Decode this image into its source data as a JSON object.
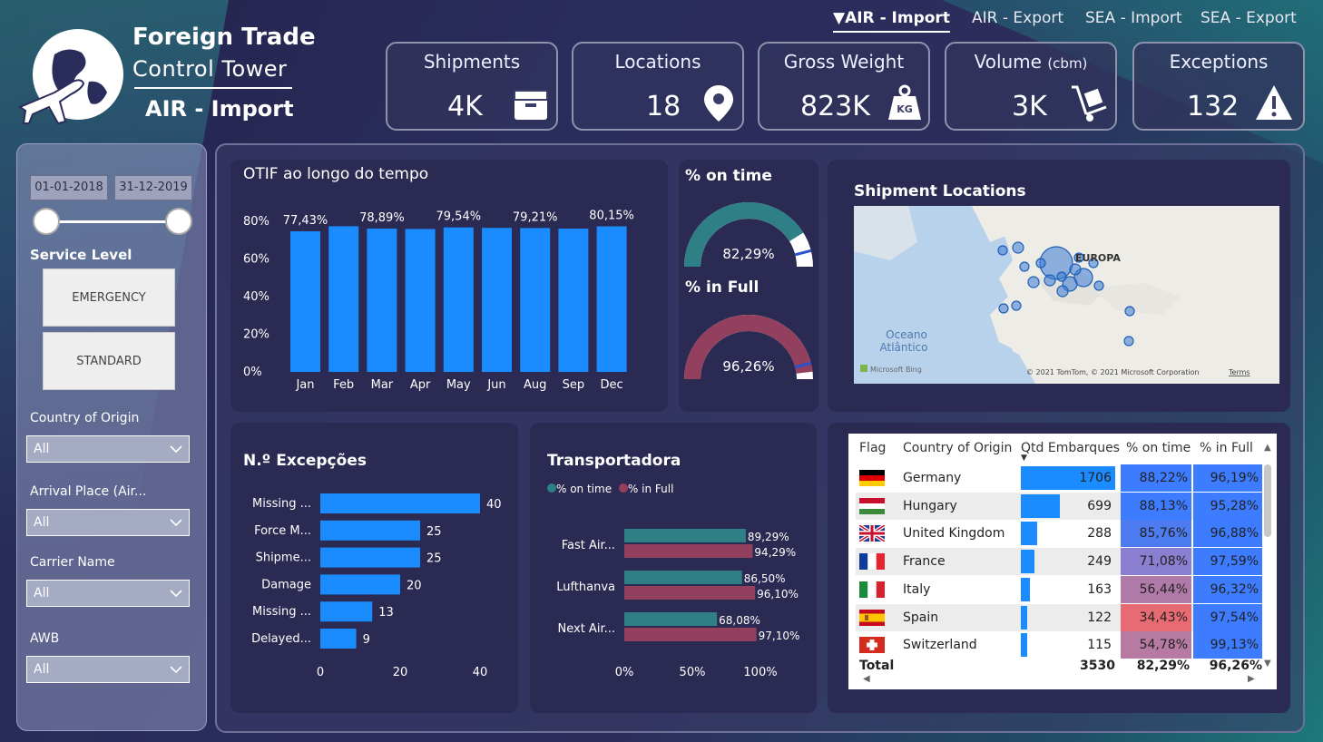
{
  "brand": {
    "line1": "Foreign Trade",
    "line2": "Control Tower",
    "subtitle": "AIR - Import"
  },
  "nav": [
    {
      "label": "AIR - Import",
      "active": true,
      "marker": "▼"
    },
    {
      "label": "AIR - Export",
      "active": false
    },
    {
      "label": "SEA - Import",
      "active": false
    },
    {
      "label": "SEA - Export",
      "active": false
    }
  ],
  "kpis": [
    {
      "label": "Shipments",
      "value": "4K",
      "icon": "box-icon"
    },
    {
      "label": "Locations",
      "value": "18",
      "icon": "map-pin-icon"
    },
    {
      "label": "Gross Weight",
      "value": "823K",
      "icon": "weight-kg-icon",
      "icon_text": "KG"
    },
    {
      "label": "Volume",
      "unit": "(cbm)",
      "value": "3K",
      "icon": "hand-truck-icon"
    },
    {
      "label": "Exceptions",
      "value": "132",
      "icon": "warning-icon"
    }
  ],
  "filters": {
    "date_from": "01-01-2018",
    "date_to": "31-12-2019",
    "service_level_label": "Service Level",
    "service_levels": [
      "EMERGENCY",
      "STANDARD"
    ],
    "dropdowns": [
      {
        "label": "Country of Origin",
        "value": "All"
      },
      {
        "label": "Arrival Place (Air...",
        "value": "All"
      },
      {
        "label": "Carrier Name",
        "value": "All"
      },
      {
        "label": "AWB",
        "value": "All"
      }
    ]
  },
  "otif": {
    "title": "OTIF ao longo do tempo"
  },
  "gauges": {
    "ontime_title": "% on time",
    "ontime_value": "82,29%",
    "ontime_fraction": 0.8229,
    "infull_title": "% in Full",
    "infull_value": "96,26%",
    "infull_fraction": 0.9626
  },
  "map": {
    "title": "Shipment Locations",
    "region_label": "EUROPA",
    "ocean_label_1": "Oceano",
    "ocean_label_2": "Atlântico",
    "bing": "Microsoft Bing",
    "copyright": "© 2021 TomTom, © 2021 Microsoft Corporation",
    "terms": "Terms"
  },
  "exceptions": {
    "title": "N.º Excepções"
  },
  "carriers": {
    "title": "Transportadora",
    "legend": [
      "% on time",
      "% in Full"
    ]
  },
  "table": {
    "headers": [
      "Flag",
      "Country of Origin",
      "Qtd Embarques",
      "% on time",
      "% in Full"
    ],
    "rows": [
      {
        "flag": "germany-flag-icon",
        "country": "Germany",
        "qty": "1706",
        "qty_num": 1706,
        "ontime": "88,22%",
        "infull": "96,19%",
        "ontime_color": "#3d7bff"
      },
      {
        "flag": "hungary-flag-icon",
        "country": "Hungary",
        "qty": "699",
        "qty_num": 699,
        "ontime": "88,13%",
        "infull": "95,28%",
        "ontime_color": "#3d7bff"
      },
      {
        "flag": "uk-flag-icon",
        "country": "United Kingdom",
        "qty": "288",
        "qty_num": 288,
        "ontime": "85,76%",
        "infull": "96,88%",
        "ontime_color": "#4d7bf0"
      },
      {
        "flag": "france-flag-icon",
        "country": "France",
        "qty": "249",
        "qty_num": 249,
        "ontime": "71,08%",
        "infull": "97,59%",
        "ontime_color": "#8a7fd0"
      },
      {
        "flag": "italy-flag-icon",
        "country": "Italy",
        "qty": "163",
        "qty_num": 163,
        "ontime": "56,44%",
        "infull": "96,32%",
        "ontime_color": "#b07aa8"
      },
      {
        "flag": "spain-flag-icon",
        "country": "Spain",
        "qty": "122",
        "qty_num": 122,
        "ontime": "34,43%",
        "infull": "97,54%",
        "ontime_color": "#e86a72"
      },
      {
        "flag": "switzerland-flag-icon",
        "country": "Switzerland",
        "qty": "115",
        "qty_num": 115,
        "ontime": "54,78%",
        "infull": "99,13%",
        "ontime_color": "#b77aa2"
      }
    ],
    "total": {
      "label": "Total",
      "qty": "3530",
      "ontime": "82,29%",
      "infull": "96,26%"
    }
  },
  "chart_data": [
    {
      "type": "bar",
      "title": "OTIF ao longo do tempo",
      "categories": [
        "Jan",
        "Feb",
        "Mar",
        "Apr",
        "May",
        "Jun",
        "Aug",
        "Sep",
        "Dec"
      ],
      "values": [
        77.43,
        80.2,
        78.89,
        78.7,
        79.54,
        79.3,
        79.21,
        78.9,
        80.15
      ],
      "data_labels": [
        "77,43%",
        "",
        "78,89%",
        "",
        "79,54%",
        "",
        "79,21%",
        "",
        "80,15%"
      ],
      "ylim": [
        0,
        80
      ],
      "yticks": [
        "0%",
        "20%",
        "40%",
        "60%",
        "80%"
      ],
      "color": "#1a8cff"
    },
    {
      "type": "bar",
      "orientation": "horizontal",
      "title": "N.º Excepções",
      "categories": [
        "Missing ...",
        "Force M...",
        "Shipme...",
        "Damage",
        "Missing ...",
        "Delayed..."
      ],
      "values": [
        40,
        25,
        25,
        20,
        13,
        9
      ],
      "xlim": [
        0,
        40
      ],
      "xticks": [
        "0",
        "20",
        "40"
      ],
      "color": "#1a8cff"
    },
    {
      "type": "bar",
      "orientation": "horizontal",
      "title": "Transportadora",
      "categories": [
        "Fast Air...",
        "Lufthanva",
        "Next Air..."
      ],
      "series": [
        {
          "name": "% on time",
          "values": [
            89.29,
            86.5,
            68.08
          ],
          "labels": [
            "89,29%",
            "86,50%",
            "68,08%"
          ],
          "color": "#2f7f87"
        },
        {
          "name": "% in Full",
          "values": [
            94.29,
            96.1,
            97.1
          ],
          "labels": [
            "94,29%",
            "96,10%",
            "97,10%"
          ],
          "color": "#93405f"
        }
      ],
      "xlim": [
        0,
        100
      ],
      "xticks": [
        "0%",
        "50%",
        "100%"
      ]
    }
  ]
}
